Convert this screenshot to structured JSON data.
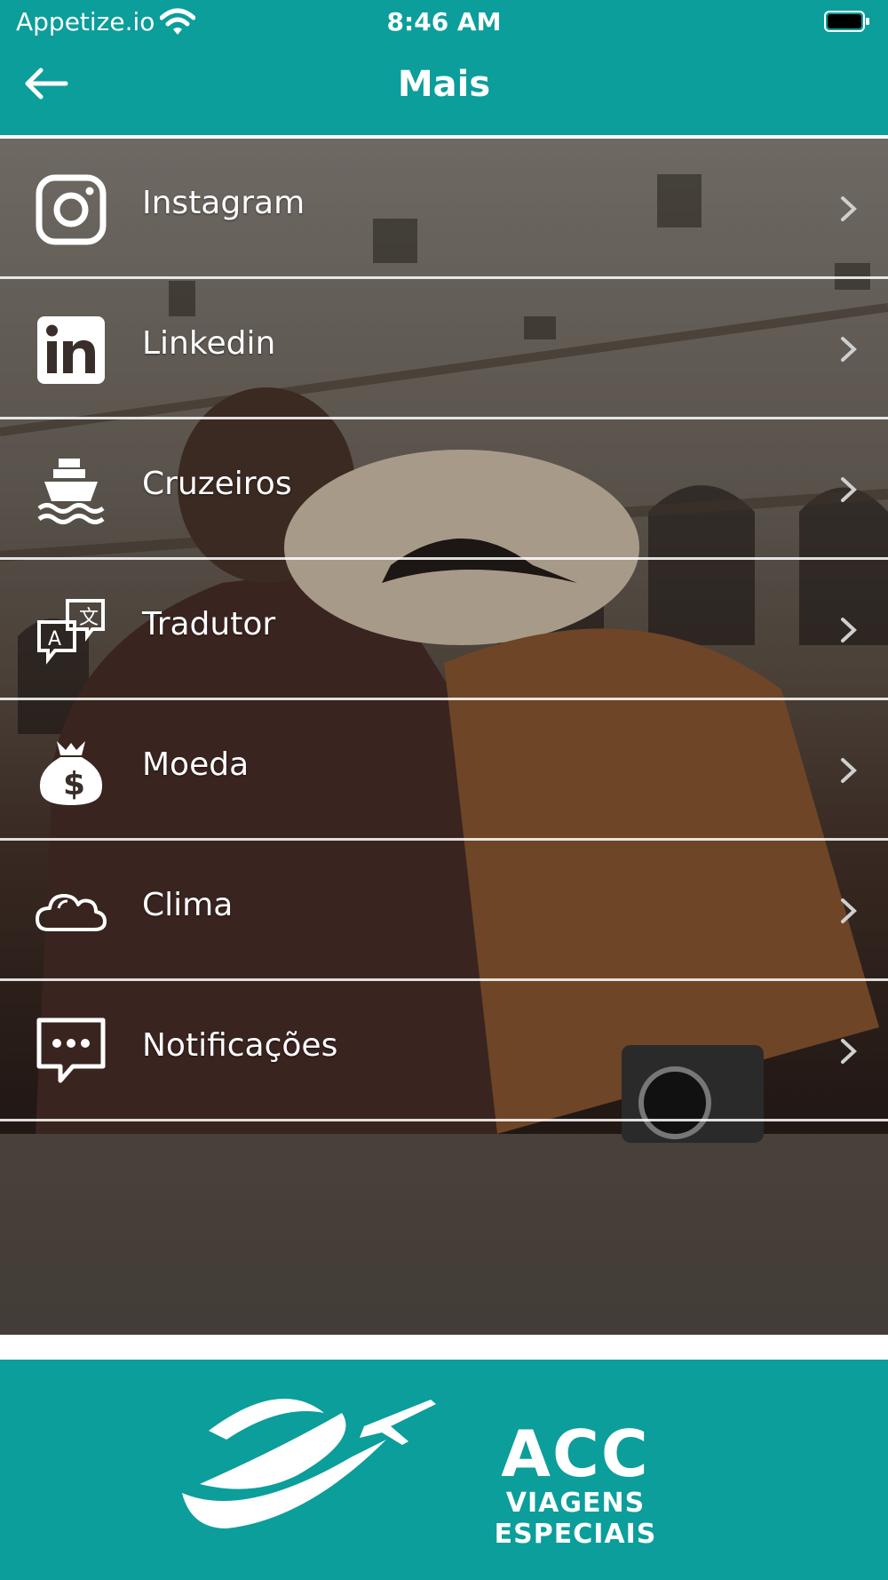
{
  "status_bar": {
    "carrier": "Appetize.io",
    "time": "8:46 AM"
  },
  "navbar": {
    "title": "Mais",
    "back_icon": "arrow-left-icon"
  },
  "menu": [
    {
      "label": "Instagram",
      "icon": "instagram-icon"
    },
    {
      "label": "Linkedin",
      "icon": "linkedin-icon"
    },
    {
      "label": "Cruzeiros",
      "icon": "ship-icon"
    },
    {
      "label": "Tradutor",
      "icon": "translate-icon"
    },
    {
      "label": "Moeda",
      "icon": "money-bag-icon"
    },
    {
      "label": "Clima",
      "icon": "cloud-icon"
    },
    {
      "label": "Notificações",
      "icon": "chat-bubble-icon"
    }
  ],
  "footer": {
    "brand_name": "ACC",
    "brand_tagline": "VIAGENS ESPECIAIS"
  },
  "colors": {
    "primary": "#0b9e9b",
    "text": "#ffffff"
  }
}
